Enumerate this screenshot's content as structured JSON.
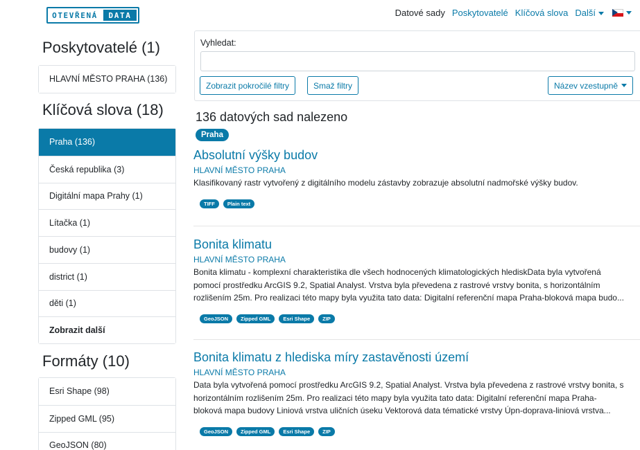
{
  "logo": {
    "part1": "OTEVŘENÁ",
    "part2": "DATA"
  },
  "nav": {
    "datasets": "Datové sady",
    "providers": "Poskytovatelé",
    "keywords": "Klíčová slova",
    "more": "Další"
  },
  "sidebar": {
    "providers": {
      "heading": "Poskytovatelé (1)",
      "items": [
        "HLAVNÍ MĚSTO PRAHA (136)"
      ]
    },
    "keywords": {
      "heading": "Klíčová slova (18)",
      "items": [
        "Praha (136)",
        "Česká republika (3)",
        "Digitální mapa Prahy (1)",
        "Lítačka (1)",
        "budovy (1)",
        "district (1)",
        "děti (1)",
        "Zobrazit další"
      ]
    },
    "formats": {
      "heading": "Formáty (10)",
      "items": [
        "Esri Shape (98)",
        "Zipped GML (95)",
        "GeoJSON (80)"
      ]
    }
  },
  "search": {
    "label": "Vyhledat:",
    "value": "",
    "placeholder": "",
    "advanced_filters": "Zobrazit pokročilé filtry",
    "clear_filters": "Smaž filtry",
    "sort": "Název vzestupně"
  },
  "results": {
    "count": "136 datových sad nalezeno",
    "active_filter": "Praha",
    "items": [
      {
        "title": "Absolutní výšky budov",
        "org": "HLAVNÍ MĚSTO PRAHA",
        "desc": [
          "Klasifikovaný rastr vytvořený z digitálního modelu zástavby zobrazuje absolutní nadmořské výšky budov."
        ],
        "formats": [
          "TIFF",
          "Plain text"
        ]
      },
      {
        "title": "Bonita klimatu",
        "org": "HLAVNÍ MĚSTO PRAHA",
        "desc": [
          "Bonita klimatu - komplexní charakteristika dle všech hodnocených klimatologických hlediskData byla vytvořená",
          "pomocí prostředku ArcGIS 9.2, Spatial Analyst. Vrstva byla převedena z rastrové vrstvy bonita, s horizontálním",
          "rozlišením 25m. Pro realizaci této mapy byla využita tato data: Digitalní referenční mapa Praha-bloková mapa budo..."
        ],
        "formats": [
          "GeoJSON",
          "Zipped GML",
          "Esri Shape",
          "ZIP"
        ]
      },
      {
        "title": "Bonita klimatu z hlediska míry zastavěnosti území",
        "org": "HLAVNÍ MĚSTO PRAHA",
        "desc": [
          "Data byla vytvořená pomocí prostředku ArcGIS 9.2, Spatial Analyst. Vrstva byla převedena z rastrové vrstvy bonita, s",
          "horizontálním rozlišením 25m. Pro realizaci této mapy byla využita tato data: Digitalní referenční mapa Praha-",
          "bloková mapa budovy Liniová vrstva uličních úseku Vektorová data tématické vrstvy Úpn-doprava-liniová vrstva..."
        ],
        "formats": [
          "GeoJSON",
          "Zipped GML",
          "Esri Shape",
          "ZIP"
        ]
      }
    ]
  }
}
